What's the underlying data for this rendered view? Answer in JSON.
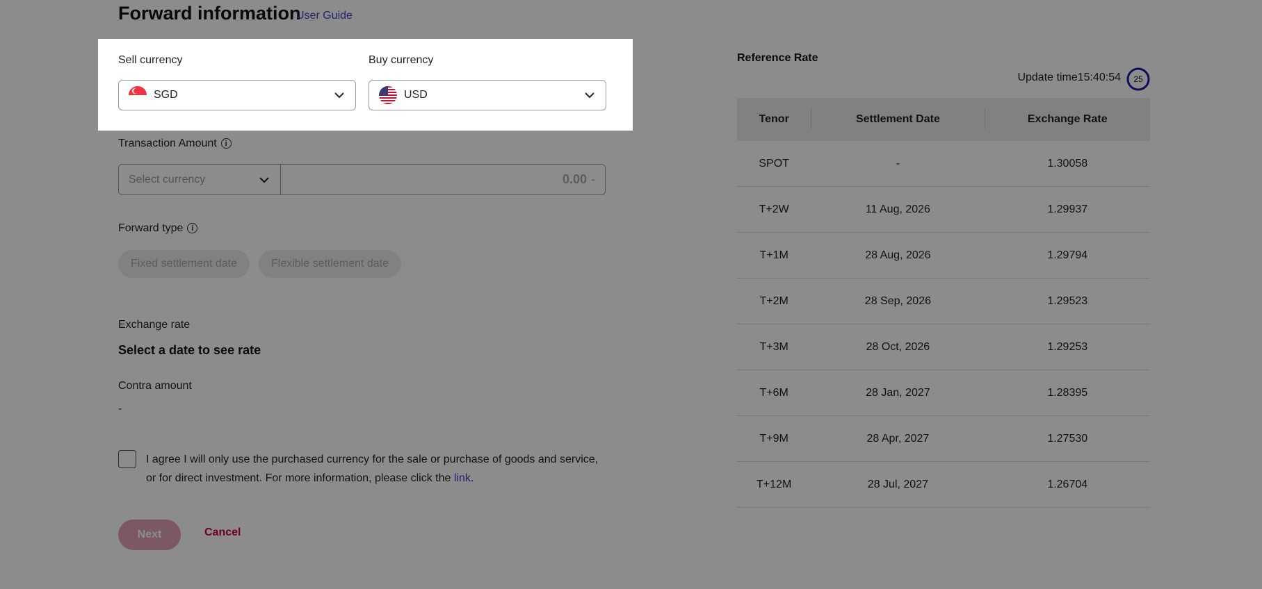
{
  "header": {
    "title": "Forward information",
    "user_guide": "User Guide"
  },
  "sell_currency": {
    "label": "Sell currency",
    "value": "SGD"
  },
  "buy_currency": {
    "label": "Buy currency",
    "value": "USD"
  },
  "transaction_amount": {
    "label": "Transaction Amount",
    "currency_placeholder": "Select currency",
    "amount": "0.00",
    "suffix": "-"
  },
  "forward_type": {
    "label": "Forward type",
    "options": [
      "Fixed settlement date",
      "Flexible settlement date"
    ]
  },
  "exchange_rate": {
    "label": "Exchange rate",
    "value": "Select a date to see rate"
  },
  "contra_amount": {
    "label": "Contra amount",
    "value": "-"
  },
  "agreement": {
    "text": "I agree I will only use the purchased currency for the sale or purchase of goods and service, or for direct investment. For more information, please click the ",
    "link": "link",
    "end": "."
  },
  "actions": {
    "next": "Next",
    "cancel": "Cancel"
  },
  "reference_rate": {
    "title": "Reference Rate",
    "update_label": "Update time",
    "update_time": "15:40:54",
    "countdown": "25",
    "columns": [
      "Tenor",
      "Settlement Date",
      "Exchange Rate"
    ],
    "rows": [
      [
        "SPOT",
        "-",
        "1.30058"
      ],
      [
        "T+2W",
        "11 Aug, 2026",
        "1.29937"
      ],
      [
        "T+1M",
        "28 Aug, 2026",
        "1.29794"
      ],
      [
        "T+2M",
        "28 Sep, 2026",
        "1.29523"
      ],
      [
        "T+3M",
        "28 Oct, 2026",
        "1.29253"
      ],
      [
        "T+6M",
        "28 Jan, 2027",
        "1.28395"
      ],
      [
        "T+9M",
        "28 Apr, 2027",
        "1.27530"
      ],
      [
        "T+12M",
        "28 Jul, 2027",
        "1.26704"
      ]
    ]
  },
  "colors": {
    "accent": "#c8003c",
    "link": "#3f3fbf",
    "overlay": "rgba(0,0,0,0.45)",
    "ring": "#1a1aa0"
  }
}
